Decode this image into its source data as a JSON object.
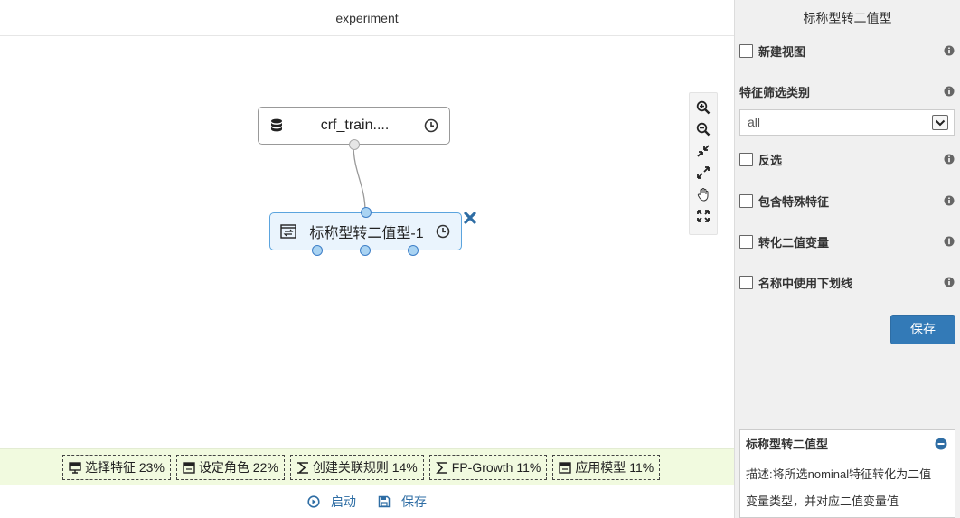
{
  "canvas": {
    "title": "experiment"
  },
  "nodes": {
    "source": {
      "label": "crf_train....",
      "icon": "database-icon"
    },
    "transform": {
      "label": "标称型转二值型-1",
      "icon": "convert-icon"
    }
  },
  "zoom_toolbar": [
    "zoom-in-icon",
    "zoom-out-icon",
    "compress-icon",
    "expand-icon",
    "hand-icon",
    "fit-screen-icon"
  ],
  "algo_bar": {
    "chips": [
      {
        "label": "选择特征 23%",
        "icon": "monitor-icon"
      },
      {
        "label": "设定角色 22%",
        "icon": "window-icon"
      },
      {
        "label": "创建关联规则 14%",
        "icon": "rule-icon"
      },
      {
        "label": "FP-Growth 11%",
        "icon": "sigma-icon"
      },
      {
        "label": "应用模型 11%",
        "icon": "window-icon"
      }
    ]
  },
  "actions": {
    "start_label": "启动",
    "save_label": "保存"
  },
  "panel": {
    "title": "标称型转二值型",
    "new_view": "新建视图",
    "filter_label": "特征筛选类别",
    "filter_value": "all",
    "invert": "反选",
    "include_special": "包含特殊特征",
    "convert_binary": "转化二值变量",
    "underscore": "名称中使用下划线",
    "save": "保存"
  },
  "description": {
    "title": "标称型转二值型",
    "line1": "描述:将所选nominal特征转化为二值",
    "line2": "变量类型，并对应二值变量值"
  },
  "colors": {
    "accent": "#337ab7",
    "node_selected_bg": "#eaf4fd",
    "algo_bar_bg": "#f1fadf",
    "panel_bg": "#f0f0f0"
  }
}
